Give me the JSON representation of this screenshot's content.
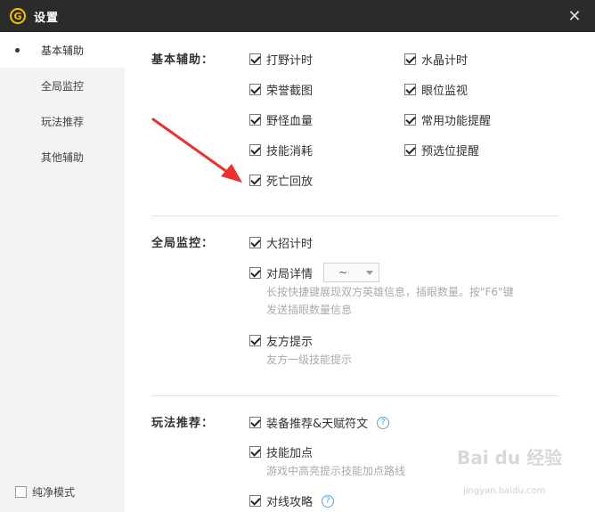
{
  "window": {
    "title": "设置",
    "logo_letter": "G",
    "close_glyph": "✕"
  },
  "sidebar": {
    "items": [
      {
        "label": "基本辅助",
        "active": true
      },
      {
        "label": "全局监控",
        "active": false
      },
      {
        "label": "玩法推荐",
        "active": false
      },
      {
        "label": "其他辅助",
        "active": false
      }
    ],
    "pure_mode_label": "纯净模式",
    "pure_mode_checked": false
  },
  "sections": {
    "basic": {
      "label": "基本辅助：",
      "options": [
        {
          "label": "打野计时",
          "checked": true
        },
        {
          "label": "水晶计时",
          "checked": true
        },
        {
          "label": "荣誉截图",
          "checked": true
        },
        {
          "label": "眼位监视",
          "checked": true
        },
        {
          "label": "野怪血量",
          "checked": true
        },
        {
          "label": "常用功能提醒",
          "checked": true
        },
        {
          "label": "技能消耗",
          "checked": true
        },
        {
          "label": "预选位提醒",
          "checked": true
        },
        {
          "label": "死亡回放",
          "checked": true
        }
      ]
    },
    "global": {
      "label": "全局监控：",
      "options": [
        {
          "label": "大招计时",
          "checked": true
        },
        {
          "label": "对局详情",
          "checked": true,
          "select_value": "~",
          "hint_line1": "长按快捷键展现双方英雄信息，插眼数量。按\"F6\"键",
          "hint_line2": "发送插眼数量信息"
        },
        {
          "label": "友方提示",
          "checked": true,
          "hint": "友方一级技能提示"
        }
      ]
    },
    "play": {
      "label": "玩法推荐：",
      "options": [
        {
          "label": "装备推荐&天赋符文",
          "checked": true,
          "help": "?"
        },
        {
          "label": "技能加点",
          "checked": true,
          "hint": "游戏中高亮提示技能加点路线"
        },
        {
          "label": "对线攻略",
          "checked": true,
          "help": "?"
        }
      ]
    }
  },
  "watermark": {
    "text": "Bai du 经验",
    "sub": "jingyan.baidu.com"
  },
  "colors": {
    "titlebar": "#2b2b2b",
    "sidebar": "#f3f3f3",
    "arrow": "#e8322f",
    "help": "#5aa8ce"
  }
}
